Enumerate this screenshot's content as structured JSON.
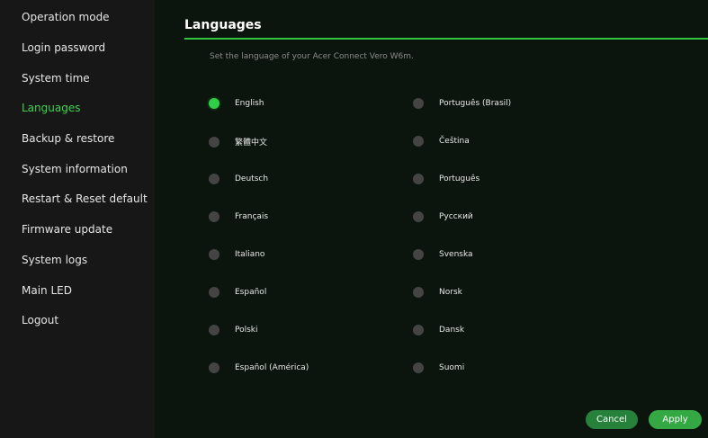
{
  "sidebar": {
    "items": [
      {
        "label": "Operation mode"
      },
      {
        "label": "Login password"
      },
      {
        "label": "System time"
      },
      {
        "label": "Languages"
      },
      {
        "label": "Backup & restore"
      },
      {
        "label": "System information"
      },
      {
        "label": "Restart & Reset default"
      },
      {
        "label": "Firmware update"
      },
      {
        "label": "System logs"
      },
      {
        "label": "Main LED"
      },
      {
        "label": "Logout"
      }
    ],
    "active_item": "Languages"
  },
  "main": {
    "title": "Languages",
    "subtitle": "Set the language of your Acer Connect Vero W6m.",
    "selected_language": "English",
    "languages_left": [
      {
        "label": "English"
      },
      {
        "label": "繁體中文"
      },
      {
        "label": "Deutsch"
      },
      {
        "label": "Français"
      },
      {
        "label": "Italiano"
      },
      {
        "label": "Español"
      },
      {
        "label": "Polski"
      },
      {
        "label": "Español (América)"
      }
    ],
    "languages_right": [
      {
        "label": "Português (Brasil)"
      },
      {
        "label": "Čeština"
      },
      {
        "label": "Português"
      },
      {
        "label": "Русский"
      },
      {
        "label": "Svenska"
      },
      {
        "label": "Norsk"
      },
      {
        "label": "Dansk"
      },
      {
        "label": "Suomi"
      }
    ]
  },
  "buttons": {
    "cancel_label": "Cancel",
    "apply_label": "Apply"
  },
  "colors": {
    "accent": "#2fc63e",
    "active_nav": "#3ed34e",
    "radio_off": "#444444",
    "radio_on": "#2fcf48"
  }
}
